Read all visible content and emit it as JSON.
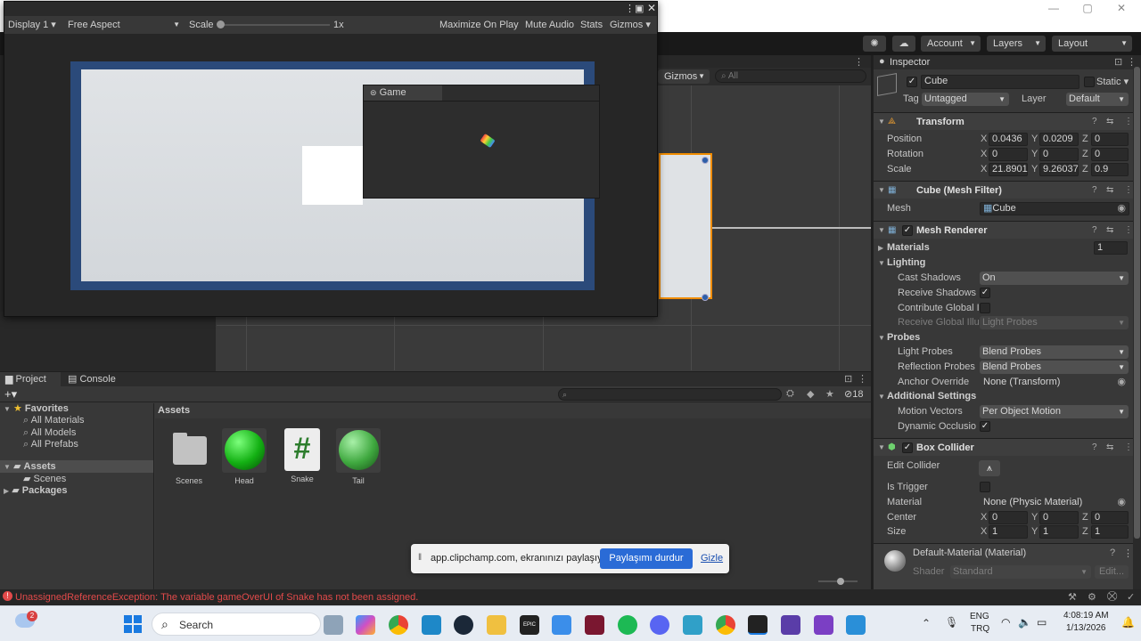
{
  "window": {
    "minimize": "—",
    "maximize": "▢",
    "close": "✕"
  },
  "toolbar": {
    "account": "Account",
    "layers": "Layers",
    "layout": "Layout"
  },
  "game_window": {
    "display": "Display 1",
    "aspect": "Free Aspect",
    "scale_label": "Scale",
    "scale_value": "1x",
    "maximize": "Maximize On Play",
    "mute": "Mute Audio",
    "stats": "Stats",
    "gizmos": "Gizmos",
    "popup_tab": "Game"
  },
  "scene": {
    "gizmos": "Gizmos",
    "search_placeholder": "All"
  },
  "inspector": {
    "tab": "Inspector",
    "object_name": "Cube",
    "static_label": "Static",
    "tag_label": "Tag",
    "tag_value": "Untagged",
    "layer_label": "Layer",
    "layer_value": "Default",
    "transform": {
      "title": "Transform",
      "position_label": "Position",
      "pos_x": "0.0436",
      "pos_y": "0.0209",
      "pos_z": "0",
      "rotation_label": "Rotation",
      "rot_x": "0",
      "rot_y": "0",
      "rot_z": "0",
      "scale_label": "Scale",
      "scale_x": "21.8901",
      "scale_y": "9.26037",
      "scale_z": "0.9"
    },
    "mesh_filter": {
      "title": "Cube (Mesh Filter)",
      "mesh_label": "Mesh",
      "mesh_value": "Cube"
    },
    "mesh_renderer": {
      "title": "Mesh Renderer",
      "materials": "Materials",
      "materials_count": "1",
      "lighting": "Lighting",
      "cast_shadows": "Cast Shadows",
      "cast_shadows_value": "On",
      "receive_shadows": "Receive Shadows",
      "contribute_gi": "Contribute Global I",
      "receive_gi": "Receive Global Illu",
      "receive_gi_value": "Light Probes",
      "probes": "Probes",
      "light_probes": "Light Probes",
      "light_probes_value": "Blend Probes",
      "reflection_probes": "Reflection Probes",
      "reflection_probes_value": "Blend Probes",
      "anchor_override": "Anchor Override",
      "anchor_override_value": "None (Transform)",
      "additional": "Additional Settings",
      "motion_vectors": "Motion Vectors",
      "motion_vectors_value": "Per Object Motion",
      "dynamic_occlusion": "Dynamic Occlusio"
    },
    "box_collider": {
      "title": "Box Collider",
      "edit_collider": "Edit Collider",
      "is_trigger": "Is Trigger",
      "material_label": "Material",
      "material_value": "None (Physic Material)",
      "center_label": "Center",
      "center_x": "0",
      "center_y": "0",
      "center_z": "0",
      "size_label": "Size",
      "size_x": "1",
      "size_y": "1",
      "size_z": "1"
    },
    "material": {
      "name": "Default-Material (Material)",
      "shader_label": "Shader",
      "shader_value": "Standard",
      "edit": "Edit..."
    }
  },
  "project": {
    "tab_project": "Project",
    "tab_console": "Console",
    "hidden_count": "18",
    "favorites": "Favorites",
    "fav_items": [
      "All Materials",
      "All Models",
      "All Prefabs"
    ],
    "assets_root": "Assets",
    "scenes_folder": "Scenes",
    "packages": "Packages",
    "assets_header": "Assets",
    "assets": [
      "Scenes",
      "Head",
      "Snake",
      "Tail"
    ]
  },
  "share_bar": {
    "message": "app.clipchamp.com, ekranınızı paylaşıyor.",
    "stop_button": "Paylaşımı durdur",
    "hide_link": "Gizle"
  },
  "status": {
    "error": "UnassignedReferenceException: The variable gameOverUI of Snake has not been assigned."
  },
  "taskbar": {
    "search": "Search",
    "lang": "ENG",
    "region": "TRQ",
    "time": "4:08:19 AM",
    "date": "1/13/2026",
    "weather_badge": "2"
  },
  "colors": {
    "accent": "#2a6bd6",
    "error": "#e24a4a",
    "selection": "#2c5d87",
    "orange": "#f08c00"
  }
}
